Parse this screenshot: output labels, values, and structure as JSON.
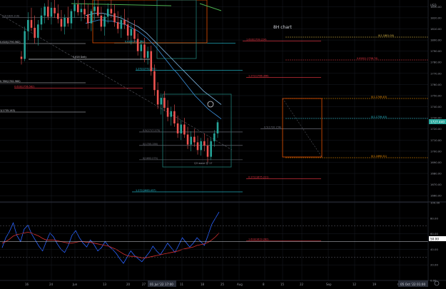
{
  "colors": {
    "background": "#000000",
    "grid": "#1a1d24",
    "axis_text": "#9598a1",
    "up_candle": "#26a69a",
    "down_candle": "#ef5350",
    "ma_fast": "#3b8fd9",
    "ma_slow": "#7fb8e6",
    "ma_green": "#4caf50",
    "ma_white": "#d1d4dc",
    "fib_cyan": "#26c6da",
    "fib_red": "#f23645",
    "fib_orange": "#ff9800",
    "fib_gray": "#787b86",
    "fib_yellow": "#e8c34a",
    "rsi_blue": "#2962ff",
    "rsi_red": "#d32f2f",
    "box_teal": "#1e7c76",
    "box_orange": "#e65100",
    "last_price_bg": "#26a69a",
    "time_highlight_bg": "#2a2e39"
  },
  "chart_data": {
    "type": "candlestick",
    "title": "8H chart",
    "annotations": {
      "count_label": "Q3 wave @ 17",
      "mini_labels": [
        "0.618 Daily"
      ]
    },
    "price_axis": {
      "ticks": [
        "1830.00",
        "1820.00",
        "1810.00",
        "1800.00",
        "1790.00",
        "1780.00",
        "1770.00",
        "1760.00",
        "1750.00",
        "1740.00",
        "1730.00",
        "1720.00",
        "1710.00",
        "1700.00",
        "1690.00",
        "1680.00",
        "1670.00",
        "1660.00"
      ],
      "top_label": "USD",
      "last_price": "1727.440",
      "ylim": [
        1655,
        1836
      ]
    },
    "rsi_axis": {
      "ticks": [
        "100.00",
        "80.00",
        "60.00",
        "40.00",
        "20.00",
        "0.00"
      ],
      "level_label": "50.00",
      "ylim": [
        0,
        100
      ]
    },
    "time_axis": {
      "ticks": [
        "16",
        "24",
        "Jun",
        "13",
        "20",
        "27",
        "Jul",
        "11",
        "18",
        "25",
        "Aug",
        "8",
        "15",
        "22",
        "Sep",
        "12",
        "19",
        "Oct"
      ],
      "highlight_left": "01 Jul '22  17:00",
      "highlight_right": "05 Oct '22  01:00"
    },
    "fib_levels": [
      {
        "label": "0.5(1820.216)",
        "value": 1820.2,
        "color": "fib_gray"
      },
      {
        "label": "0.618(1797.342)",
        "value": 1797.3,
        "color": "fib_cyan"
      },
      {
        "label": "1.272(1772.953)",
        "value": 1772.9,
        "color": "fib_cyan"
      },
      {
        "label": "0.618(1756.582)",
        "value": 1756.6,
        "color": "fib_red"
      },
      {
        "label": "0.5(1717.275)",
        "value": 1717.3,
        "color": "fib_gray"
      },
      {
        "label": "0(1705.156)",
        "value": 1705.2,
        "color": "fib_gray"
      },
      {
        "label": "0(1692.275)",
        "value": 1692.3,
        "color": "fib_gray"
      },
      {
        "label": "1.272(1663.437)",
        "value": 1663.4,
        "color": "fib_cyan"
      },
      {
        "label": "1.618(1799.224)",
        "value": 1799.2,
        "color": "fib_red"
      },
      {
        "label": "1.272(1766.396)",
        "value": 1766.4,
        "color": "fib_red"
      },
      {
        "label": "0.5(1720.156)",
        "value": 1720.2,
        "color": "fib_gray"
      },
      {
        "label": "0.272(1675.221)",
        "value": 1675.2,
        "color": "fib_red"
      },
      {
        "label": "1.618(1619.282)",
        "value": 1619.3,
        "color": "fib_red"
      }
    ],
    "left_labels": [
      "0.786(1762.960)",
      "1(1735.143)",
      "0.618(1790.562)"
    ],
    "right_tags": [
      {
        "label": "0(1.1801.00)",
        "color": "fib_yellow"
      },
      {
        "label": "0.618(1.1798.74)",
        "color": "fib_red"
      },
      {
        "label": "0(1.1749.45)",
        "color": "fib_orange"
      },
      {
        "label": "0(1.1739.45)",
        "color": "fib_cyan"
      },
      {
        "label": "0(1.1690.51)",
        "color": "fib_orange"
      }
    ],
    "candles": [
      [
        1785,
        1790,
        1778,
        1783
      ],
      [
        1783,
        1812,
        1781,
        1808
      ],
      [
        1808,
        1825,
        1800,
        1818
      ],
      [
        1818,
        1829,
        1808,
        1811
      ],
      [
        1811,
        1822,
        1797,
        1802
      ],
      [
        1802,
        1818,
        1795,
        1814
      ],
      [
        1814,
        1829,
        1809,
        1822
      ],
      [
        1822,
        1833,
        1815,
        1830
      ],
      [
        1830,
        1836,
        1818,
        1821
      ],
      [
        1821,
        1834,
        1814,
        1829
      ],
      [
        1829,
        1836,
        1820,
        1824
      ],
      [
        1824,
        1832,
        1815,
        1819
      ],
      [
        1819,
        1827,
        1808,
        1812
      ],
      [
        1812,
        1823,
        1805,
        1820
      ],
      [
        1820,
        1830,
        1812,
        1815
      ],
      [
        1815,
        1828,
        1810,
        1826
      ],
      [
        1826,
        1836,
        1820,
        1832
      ],
      [
        1832,
        1836,
        1822,
        1825
      ],
      [
        1825,
        1833,
        1817,
        1828
      ],
      [
        1828,
        1836,
        1819,
        1823
      ],
      [
        1823,
        1832,
        1810,
        1815
      ],
      [
        1815,
        1828,
        1808,
        1826
      ],
      [
        1826,
        1836,
        1818,
        1830
      ],
      [
        1830,
        1836,
        1820,
        1822
      ],
      [
        1822,
        1830,
        1808,
        1812
      ],
      [
        1812,
        1824,
        1804,
        1821
      ],
      [
        1821,
        1833,
        1815,
        1828
      ],
      [
        1828,
        1836,
        1820,
        1824
      ],
      [
        1824,
        1832,
        1812,
        1816
      ],
      [
        1816,
        1826,
        1806,
        1810
      ],
      [
        1810,
        1822,
        1802,
        1818
      ],
      [
        1818,
        1828,
        1810,
        1814
      ],
      [
        1814,
        1820,
        1800,
        1804
      ],
      [
        1804,
        1814,
        1796,
        1810
      ],
      [
        1810,
        1818,
        1798,
        1801
      ],
      [
        1801,
        1806,
        1786,
        1790
      ],
      [
        1790,
        1800,
        1782,
        1796
      ],
      [
        1796,
        1802,
        1780,
        1784
      ],
      [
        1784,
        1794,
        1778,
        1790
      ],
      [
        1790,
        1795,
        1768,
        1772
      ],
      [
        1772,
        1778,
        1750,
        1755
      ],
      [
        1755,
        1762,
        1738,
        1742
      ],
      [
        1742,
        1752,
        1733,
        1748
      ],
      [
        1748,
        1754,
        1736,
        1739
      ],
      [
        1739,
        1746,
        1727,
        1731
      ],
      [
        1731,
        1740,
        1723,
        1736
      ],
      [
        1736,
        1742,
        1722,
        1725
      ],
      [
        1725,
        1732,
        1712,
        1716
      ],
      [
        1716,
        1728,
        1710,
        1724
      ],
      [
        1724,
        1730,
        1712,
        1715
      ],
      [
        1715,
        1722,
        1702,
        1706
      ],
      [
        1706,
        1718,
        1700,
        1713
      ],
      [
        1713,
        1720,
        1704,
        1708
      ],
      [
        1708,
        1714,
        1697,
        1701
      ],
      [
        1701,
        1712,
        1696,
        1709
      ],
      [
        1709,
        1716,
        1700,
        1705
      ],
      [
        1705,
        1712,
        1690,
        1695
      ],
      [
        1695,
        1712,
        1692,
        1709
      ],
      [
        1709,
        1719,
        1704,
        1716
      ],
      [
        1716,
        1728,
        1712,
        1726
      ]
    ],
    "ma_fast": [
      1815,
      1816,
      1817,
      1818,
      1818,
      1817,
      1817,
      1816,
      1815,
      1814,
      1812,
      1810,
      1808,
      1805,
      1802,
      1798,
      1794,
      1789,
      1784,
      1779,
      1774,
      1770,
      1765,
      1760,
      1755,
      1750,
      1746,
      1742,
      1738,
      1735,
      1732,
      1729
    ],
    "ma_slow": [
      1822,
      1823,
      1824,
      1824,
      1824,
      1823,
      1822,
      1821,
      1820,
      1818,
      1816,
      1814,
      1812,
      1809,
      1806,
      1802,
      1798,
      1794,
      1790,
      1786,
      1782,
      1778,
      1774,
      1770,
      1766,
      1762,
      1758,
      1754,
      1751,
      1748,
      1745,
      1742
    ],
    "rsi": [
      42,
      55,
      63,
      74,
      58,
      50,
      66,
      71,
      60,
      52,
      44,
      38,
      50,
      61,
      56,
      47,
      40,
      36,
      45,
      58,
      64,
      55,
      48,
      43,
      52,
      46,
      38,
      42,
      50,
      44,
      40,
      35,
      28,
      22,
      30,
      38,
      32,
      28,
      24,
      30,
      36,
      44,
      38,
      33,
      40,
      48,
      42,
      36,
      45,
      55,
      49,
      43,
      48,
      55,
      50,
      45,
      58,
      72,
      80,
      88
    ],
    "rsi_ma": [
      48,
      50,
      53,
      57,
      59,
      60,
      61,
      62,
      61,
      59,
      57,
      54,
      52,
      52,
      52,
      51,
      50,
      49,
      48,
      48,
      49,
      50,
      50,
      49,
      49,
      48,
      47,
      46,
      45,
      44,
      42,
      40,
      37,
      34,
      32,
      31,
      31,
      30,
      29,
      29,
      30,
      31,
      32,
      33,
      34,
      35,
      36,
      37,
      38,
      40,
      41,
      42,
      43,
      45,
      46,
      47,
      49,
      52,
      56,
      61
    ]
  }
}
